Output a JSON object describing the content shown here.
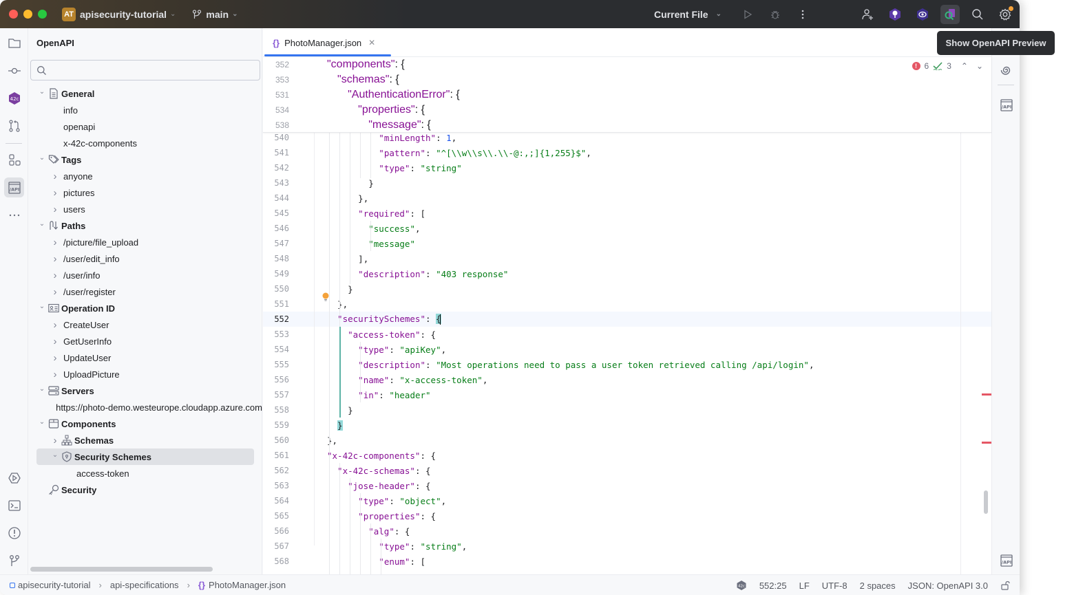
{
  "titlebar": {
    "project_initials": "AT",
    "project_name": "apisecurity-tutorial",
    "branch": "main",
    "run_config": "Current File"
  },
  "tooltip": "Show OpenAPI Preview",
  "panel": {
    "title": "OpenAPI",
    "search_placeholder": "",
    "tree": [
      {
        "label": "General",
        "level": 0,
        "expanded": true,
        "bold": true,
        "icon": "document-icon"
      },
      {
        "label": "info",
        "level": 1,
        "leaf": true
      },
      {
        "label": "openapi",
        "level": 1,
        "leaf": true
      },
      {
        "label": "x-42c-components",
        "level": 1,
        "leaf": true
      },
      {
        "label": "Tags",
        "level": 0,
        "expanded": true,
        "bold": true,
        "icon": "tag-icon"
      },
      {
        "label": "anyone",
        "level": 1
      },
      {
        "label": "pictures",
        "level": 1
      },
      {
        "label": "users",
        "level": 1
      },
      {
        "label": "Paths",
        "level": 0,
        "expanded": true,
        "bold": true,
        "icon": "paths-icon"
      },
      {
        "label": "/picture/file_upload",
        "level": 1
      },
      {
        "label": "/user/edit_info",
        "level": 1
      },
      {
        "label": "/user/info",
        "level": 1
      },
      {
        "label": "/user/register",
        "level": 1
      },
      {
        "label": "Operation ID",
        "level": 0,
        "expanded": true,
        "bold": true,
        "icon": "id-card-icon"
      },
      {
        "label": "CreateUser",
        "level": 1
      },
      {
        "label": "GetUserInfo",
        "level": 1
      },
      {
        "label": "UpdateUser",
        "level": 1
      },
      {
        "label": "UploadPicture",
        "level": 1
      },
      {
        "label": "Servers",
        "level": 0,
        "expanded": true,
        "bold": true,
        "icon": "server-icon"
      },
      {
        "label": "https://photo-demo.westeurope.cloudapp.azure.com",
        "level": 1,
        "leaf": true
      },
      {
        "label": "Components",
        "level": 0,
        "expanded": true,
        "bold": true,
        "icon": "box-icon"
      },
      {
        "label": "Schemas",
        "level": 1,
        "bold": true,
        "icon": "hierarchy-icon"
      },
      {
        "label": "Security Schemes",
        "level": 1,
        "expanded": true,
        "bold": true,
        "icon": "shield-icon",
        "selected": true
      },
      {
        "label": "access-token",
        "level": 2,
        "leaf": true
      },
      {
        "label": "Security",
        "level": 0,
        "leaf": true,
        "bold": true,
        "icon": "key-icon"
      }
    ]
  },
  "editor": {
    "tab_label": "PhotoManager.json",
    "inspections": {
      "errors": "6",
      "warnings": "3"
    },
    "sticky_lines": [
      {
        "num": "352",
        "indent": 1,
        "tokens": [
          [
            "k",
            "\"components\""
          ],
          [
            "p",
            ": {"
          ]
        ]
      },
      {
        "num": "353",
        "indent": 2,
        "tokens": [
          [
            "k",
            "\"schemas\""
          ],
          [
            "p",
            ": {"
          ]
        ]
      },
      {
        "num": "531",
        "indent": 3,
        "tokens": [
          [
            "k",
            "\"AuthenticationError\""
          ],
          [
            "p",
            ": {"
          ]
        ]
      },
      {
        "num": "534",
        "indent": 4,
        "tokens": [
          [
            "k",
            "\"properties\""
          ],
          [
            "p",
            ": {"
          ]
        ]
      },
      {
        "num": "538",
        "indent": 5,
        "tokens": [
          [
            "k",
            "\"message\""
          ],
          [
            "p",
            ": {"
          ]
        ]
      }
    ],
    "lines": [
      {
        "num": "540",
        "indent": 6,
        "tokens": [
          [
            "k",
            "\"minLength\""
          ],
          [
            "p",
            ": "
          ],
          [
            "n",
            "1"
          ],
          [
            "p",
            ","
          ]
        ]
      },
      {
        "num": "541",
        "indent": 6,
        "tokens": [
          [
            "k",
            "\"pattern\""
          ],
          [
            "p",
            ": "
          ],
          [
            "s",
            "\"^[\\\\w\\\\s\\\\.\\\\-@:,;]{1,255}$\""
          ],
          [
            "p",
            ","
          ]
        ]
      },
      {
        "num": "542",
        "indent": 6,
        "tokens": [
          [
            "k",
            "\"type\""
          ],
          [
            "p",
            ": "
          ],
          [
            "s",
            "\"string\""
          ]
        ]
      },
      {
        "num": "543",
        "indent": 5,
        "tokens": [
          [
            "p",
            "}"
          ]
        ]
      },
      {
        "num": "544",
        "indent": 4,
        "tokens": [
          [
            "p",
            "},"
          ]
        ]
      },
      {
        "num": "545",
        "indent": 4,
        "tokens": [
          [
            "k",
            "\"required\""
          ],
          [
            "p",
            ": ["
          ]
        ]
      },
      {
        "num": "546",
        "indent": 5,
        "tokens": [
          [
            "s",
            "\"success\""
          ],
          [
            "p",
            ","
          ]
        ]
      },
      {
        "num": "547",
        "indent": 5,
        "tokens": [
          [
            "s",
            "\"message\""
          ]
        ]
      },
      {
        "num": "548",
        "indent": 4,
        "tokens": [
          [
            "p",
            "],"
          ]
        ]
      },
      {
        "num": "549",
        "indent": 4,
        "tokens": [
          [
            "k",
            "\"description\""
          ],
          [
            "p",
            ": "
          ],
          [
            "s",
            "\"403 response\""
          ]
        ]
      },
      {
        "num": "550",
        "indent": 3,
        "tokens": [
          [
            "p",
            "}"
          ]
        ]
      },
      {
        "num": "551",
        "indent": 2,
        "tokens": [
          [
            "p",
            "},"
          ]
        ]
      },
      {
        "num": "552",
        "indent": 2,
        "tokens": [
          [
            "k",
            "\"securitySchemes\""
          ],
          [
            "p",
            ": "
          ],
          [
            "m",
            "{"
          ]
        ],
        "current": true
      },
      {
        "num": "553",
        "indent": 3,
        "tokens": [
          [
            "k",
            "\"access-token\""
          ],
          [
            "p",
            ": {"
          ]
        ]
      },
      {
        "num": "554",
        "indent": 4,
        "tokens": [
          [
            "k",
            "\"type\""
          ],
          [
            "p",
            ": "
          ],
          [
            "s",
            "\"apiKey\""
          ],
          [
            "p",
            ","
          ]
        ]
      },
      {
        "num": "555",
        "indent": 4,
        "tokens": [
          [
            "k",
            "\"description\""
          ],
          [
            "p",
            ": "
          ],
          [
            "s",
            "\"Most operations need to pass a user token retrieved calling /api/login\""
          ],
          [
            "p",
            ","
          ]
        ]
      },
      {
        "num": "556",
        "indent": 4,
        "tokens": [
          [
            "k",
            "\"name\""
          ],
          [
            "p",
            ": "
          ],
          [
            "s",
            "\"x-access-token\""
          ],
          [
            "p",
            ","
          ]
        ]
      },
      {
        "num": "557",
        "indent": 4,
        "tokens": [
          [
            "k",
            "\"in\""
          ],
          [
            "p",
            ": "
          ],
          [
            "s",
            "\"header\""
          ]
        ]
      },
      {
        "num": "558",
        "indent": 3,
        "tokens": [
          [
            "p",
            "}"
          ]
        ]
      },
      {
        "num": "559",
        "indent": 2,
        "tokens": [
          [
            "m",
            "}"
          ]
        ]
      },
      {
        "num": "560",
        "indent": 1,
        "tokens": [
          [
            "p",
            "},"
          ]
        ]
      },
      {
        "num": "561",
        "indent": 1,
        "tokens": [
          [
            "k",
            "\"x-42c-components\""
          ],
          [
            "p",
            ": {"
          ]
        ]
      },
      {
        "num": "562",
        "indent": 2,
        "tokens": [
          [
            "k",
            "\"x-42c-schemas\""
          ],
          [
            "p",
            ": {"
          ]
        ]
      },
      {
        "num": "563",
        "indent": 3,
        "tokens": [
          [
            "k",
            "\"jose-header\""
          ],
          [
            "p",
            ": {"
          ]
        ]
      },
      {
        "num": "564",
        "indent": 4,
        "tokens": [
          [
            "k",
            "\"type\""
          ],
          [
            "p",
            ": "
          ],
          [
            "s",
            "\"object\""
          ],
          [
            "p",
            ","
          ]
        ]
      },
      {
        "num": "565",
        "indent": 4,
        "tokens": [
          [
            "k",
            "\"properties\""
          ],
          [
            "p",
            ": {"
          ]
        ]
      },
      {
        "num": "566",
        "indent": 5,
        "tokens": [
          [
            "k",
            "\"alg\""
          ],
          [
            "p",
            ": {"
          ]
        ]
      },
      {
        "num": "567",
        "indent": 6,
        "tokens": [
          [
            "k",
            "\"type\""
          ],
          [
            "p",
            ": "
          ],
          [
            "s",
            "\"string\""
          ],
          [
            "p",
            ","
          ]
        ]
      },
      {
        "num": "568",
        "indent": 6,
        "tokens": [
          [
            "k",
            "\"enum\""
          ],
          [
            "p",
            ": ["
          ]
        ]
      }
    ]
  },
  "statusbar": {
    "breadcrumb": [
      "apisecurity-tutorial",
      "api-specifications",
      "PhotoManager.json"
    ],
    "position": "552:25",
    "line_ending": "LF",
    "encoding": "UTF-8",
    "indent": "2 spaces",
    "file_type": "JSON: OpenAPI 3.0"
  }
}
